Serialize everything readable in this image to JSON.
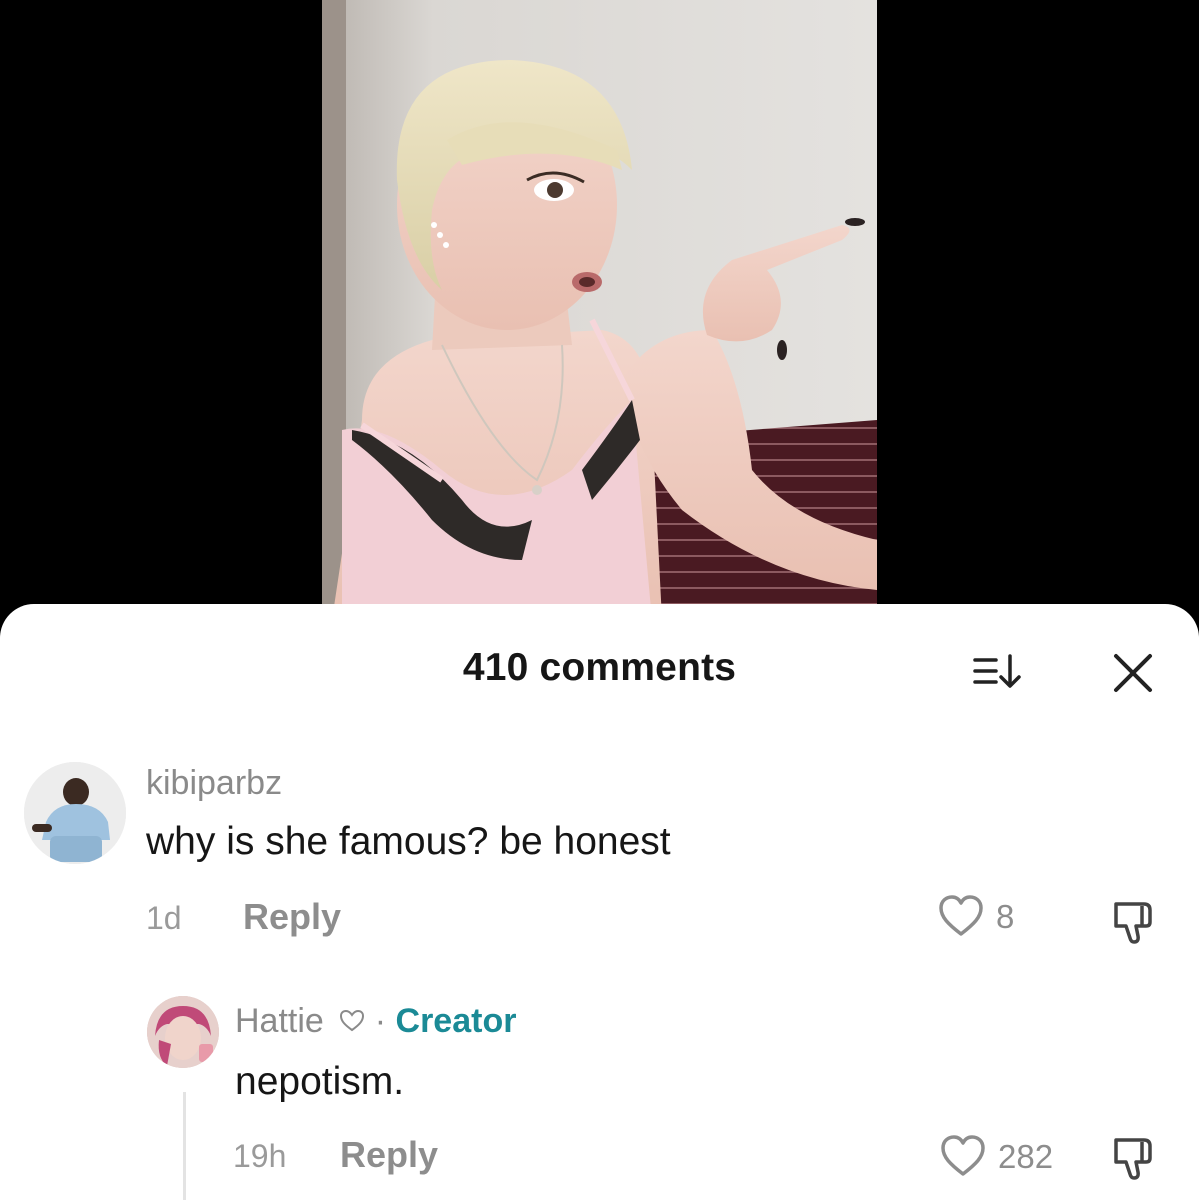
{
  "sheet": {
    "title": "410 comments",
    "sort_icon": "sort-descending-icon",
    "close_icon": "close-icon"
  },
  "comments": [
    {
      "username": "kibiparbz",
      "text": "why is she famous? be honest",
      "time": "1d",
      "reply_label": "Reply",
      "likes": "8"
    },
    {
      "username": "Hattie",
      "separator": "·",
      "badge": "Creator",
      "text": "nepotism.",
      "time": "19h",
      "reply_label": "Reply",
      "likes": "282"
    }
  ],
  "colors": {
    "creator_badge": "#1b8a96",
    "muted_text": "#8d8d8d",
    "primary_text": "#161616"
  }
}
